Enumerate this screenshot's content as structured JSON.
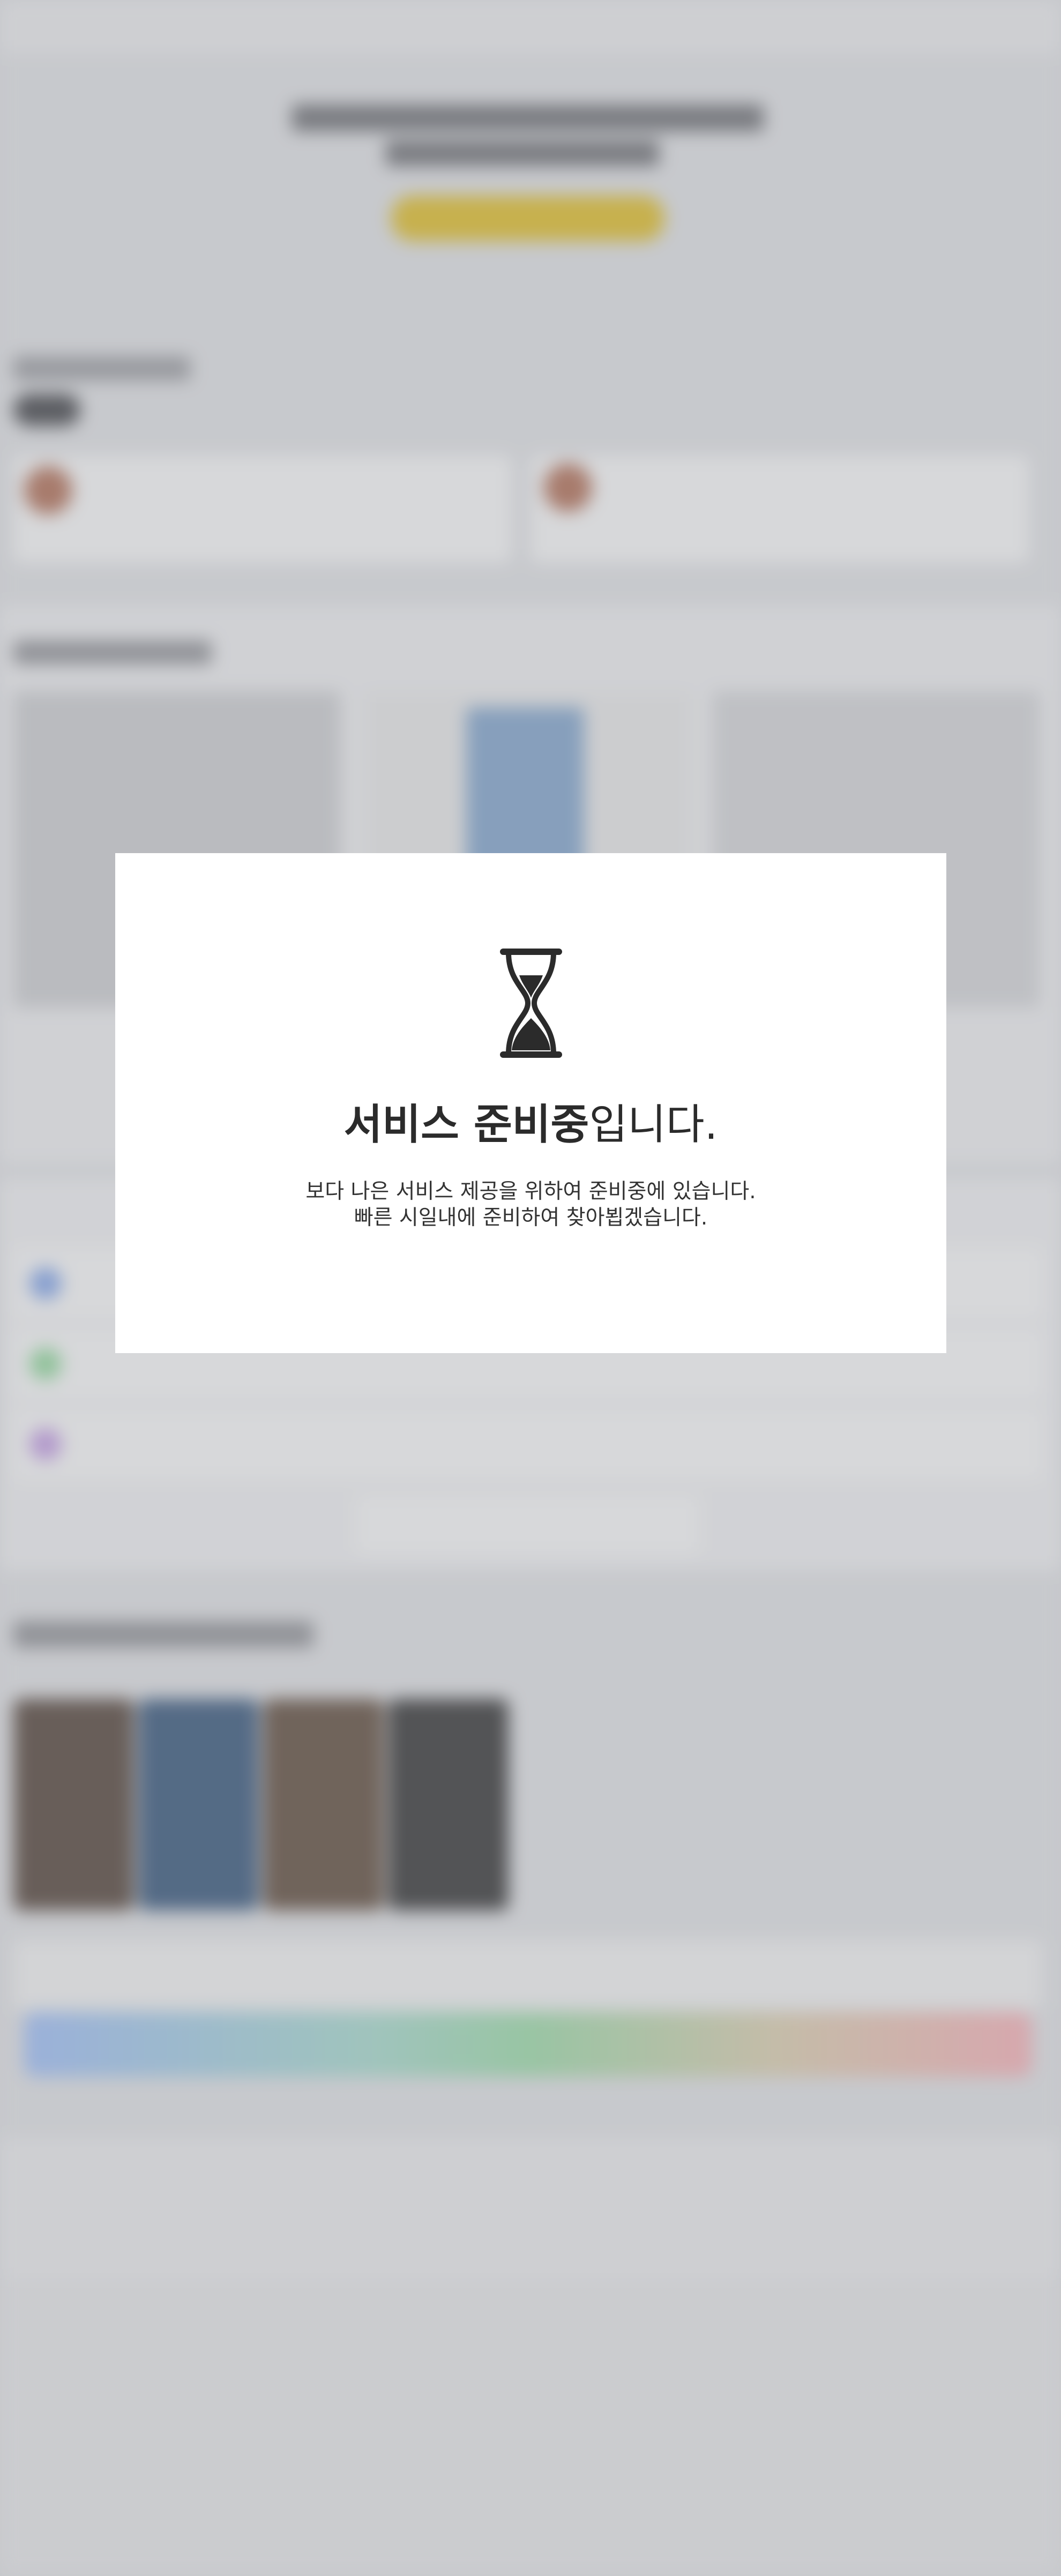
{
  "modal": {
    "title_bold": "서비스 준비중",
    "title_rest": "입니다.",
    "message_line1": "보다 나은 서비스 제공을 위하여 준비중에 있습니다.",
    "message_line2": "빠른 시일내에 준비하여 찾아뵙겠습니다."
  },
  "icons": {
    "hourglass": "hourglass-icon"
  },
  "colors": {
    "overlay": "#96989e",
    "modal_bg": "#ffffff",
    "cta_yellow": "#e6c01e",
    "text": "#2b2b2b"
  }
}
